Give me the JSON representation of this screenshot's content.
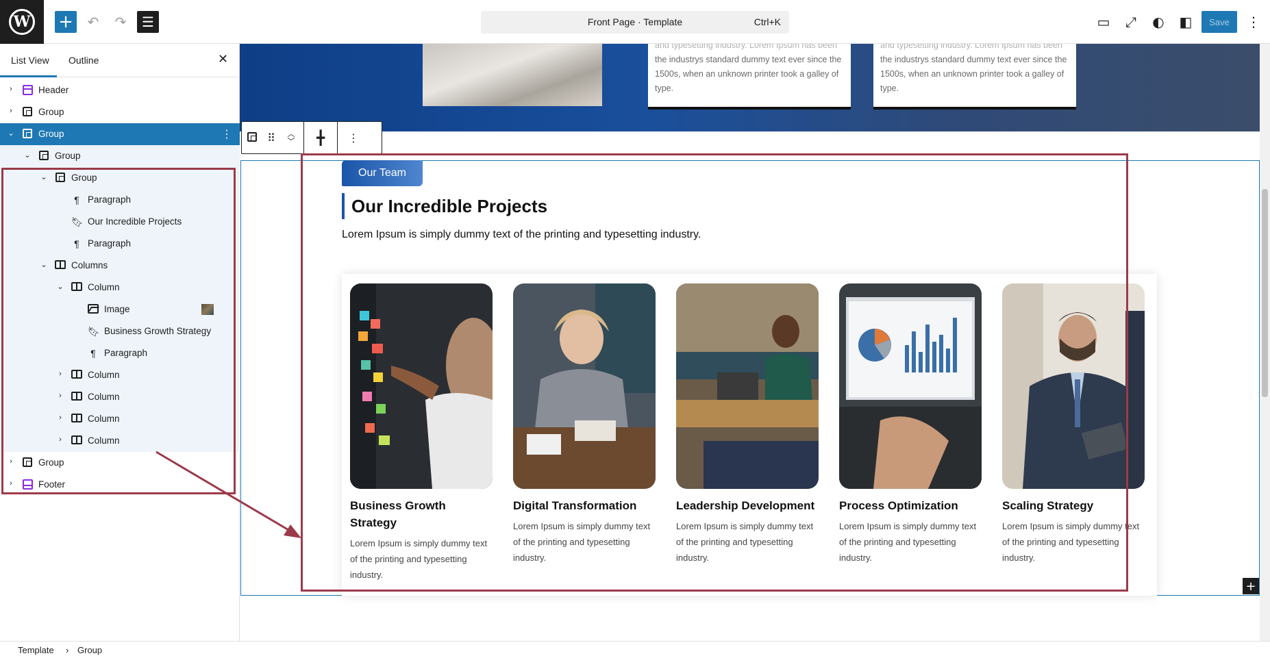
{
  "topbar": {
    "command_title": "Front Page · Template",
    "command_shortcut": "Ctrl+K",
    "save_label": "Save"
  },
  "sidebar": {
    "tabs": [
      "List View",
      "Outline"
    ],
    "tree": [
      {
        "label": "Header"
      },
      {
        "label": "Group"
      },
      {
        "label": "Group"
      },
      {
        "label": "Group"
      },
      {
        "label": "Group"
      },
      {
        "label": "Paragraph"
      },
      {
        "label": "Our Incredible Projects"
      },
      {
        "label": "Paragraph"
      },
      {
        "label": "Columns"
      },
      {
        "label": "Column"
      },
      {
        "label": "Image"
      },
      {
        "label": "Business Growth Strategy"
      },
      {
        "label": "Paragraph"
      },
      {
        "label": "Column"
      },
      {
        "label": "Column"
      },
      {
        "label": "Column"
      },
      {
        "label": "Column"
      },
      {
        "label": "Group"
      },
      {
        "label": "Footer"
      }
    ]
  },
  "hero_cards": [
    {
      "lines": [
        "and typesetting industry. Lorem Ipsum has been",
        "the industrys standard dummy text ever since the",
        "1500s, when an unknown printer took a galley of",
        "type."
      ]
    },
    {
      "lines": [
        "and typesetting industry. Lorem Ipsum has been",
        "the industrys standard dummy text ever since the",
        "1500s, when an unknown printer took a galley of",
        "type."
      ]
    }
  ],
  "section": {
    "badge": "Our Team",
    "title": "Our Incredible Projects",
    "description": "Lorem Ipsum is simply dummy text of the printing and typesetting industry."
  },
  "projects": [
    {
      "title": "Business Growth Strategy",
      "text": "Lorem Ipsum is simply dummy text of the printing and typesetting industry."
    },
    {
      "title": "Digital Transformation",
      "text": "Lorem Ipsum is simply dummy text of the printing and typesetting industry."
    },
    {
      "title": "Leadership Development",
      "text": "Lorem Ipsum is simply dummy text of the printing and typesetting industry."
    },
    {
      "title": "Process Optimization",
      "text": "Lorem Ipsum is simply dummy text of the printing and typesetting industry."
    },
    {
      "title": "Scaling Strategy",
      "text": "Lorem Ipsum is simply dummy text of the printing and typesetting industry."
    }
  ],
  "breadcrumb": [
    "Template",
    "Group"
  ],
  "colors": {
    "accent": "#1e78b4",
    "annotation": "#9b3b4a",
    "brand_blue": "#1a55a8"
  }
}
